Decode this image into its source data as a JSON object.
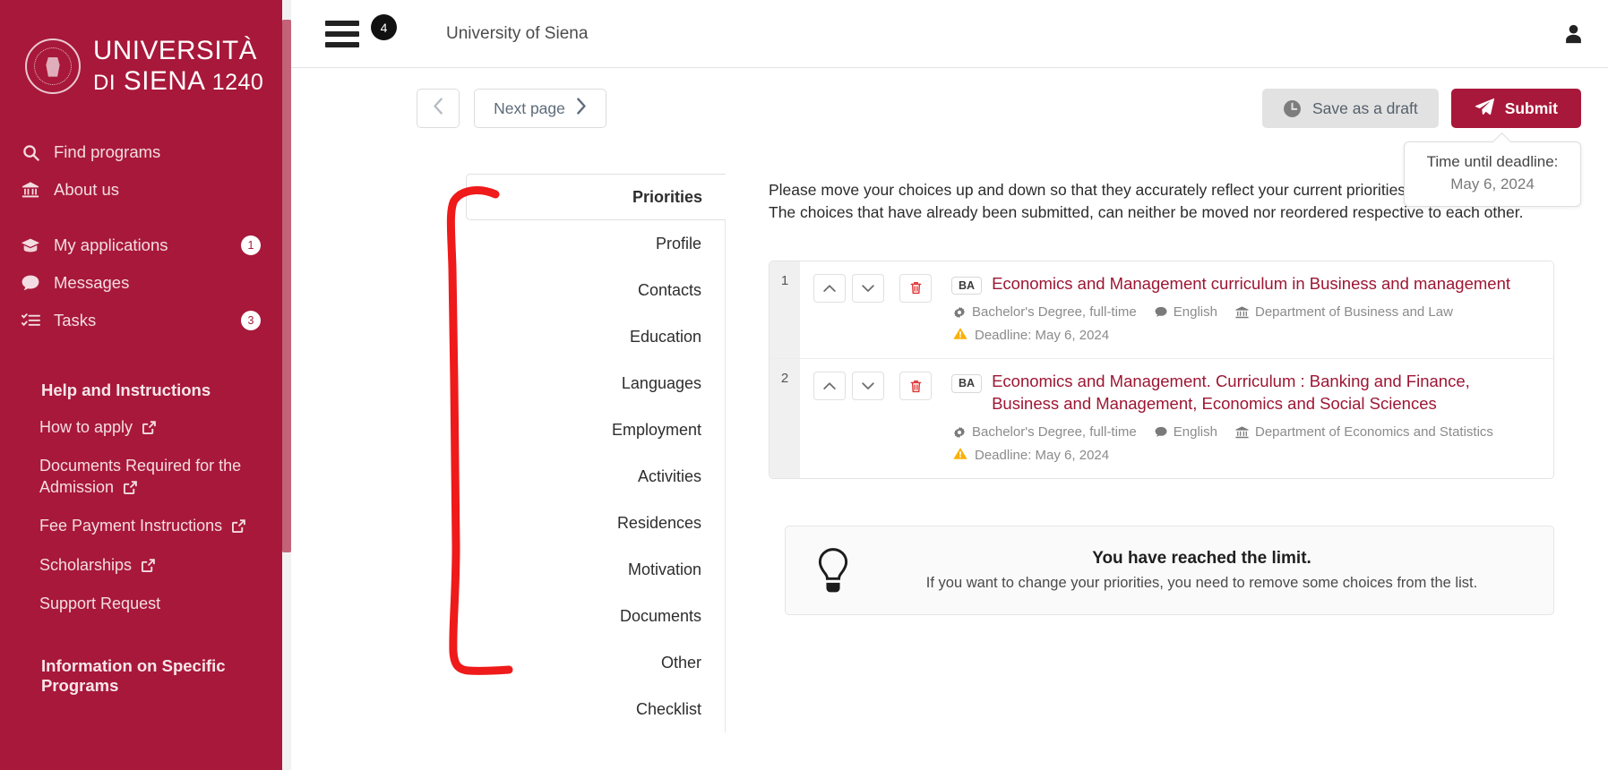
{
  "sidebar": {
    "brand": {
      "line1": "UNIVERSITÀ",
      "line2_prefix": "DI",
      "line2_main": "SIENA",
      "year": "1240",
      "crest_icon": "university-crest-icon"
    },
    "nav": [
      {
        "label": "Find programs",
        "icon": "search-icon",
        "badge": ""
      },
      {
        "label": "About us",
        "icon": "bank-icon",
        "badge": ""
      },
      {
        "label": "My applications",
        "icon": "graduation-cap-icon",
        "badge": "1"
      },
      {
        "label": "Messages",
        "icon": "chat-bubble-icon",
        "badge": ""
      },
      {
        "label": "Tasks",
        "icon": "checklist-icon",
        "badge": "3"
      }
    ],
    "help_title": "Help and Instructions",
    "help_links": [
      {
        "label": "How to apply",
        "external": true
      },
      {
        "label": "Documents Required for the Admission",
        "external": true
      },
      {
        "label": "Fee Payment Instructions",
        "external": true
      },
      {
        "label": "Scholarships",
        "external": true
      },
      {
        "label": "Support Request",
        "external": false
      }
    ],
    "section_title_2": "Information on Specific Programs",
    "accent_color": "#a8183a"
  },
  "topbar": {
    "menu_icon": "hamburger-menu-icon",
    "menu_badge": "4",
    "title": "University of Siena",
    "account_icon": "user-account-icon"
  },
  "actionbar": {
    "prev_label": "",
    "prev_icon": "chevron-left-icon",
    "next_label": "Next page",
    "next_icon": "chevron-right-icon",
    "save_draft_label": "Save as a draft",
    "save_draft_icon": "clock-icon",
    "submit_label": "Submit",
    "submit_icon": "paper-plane-icon",
    "submit_color": "#a8183a"
  },
  "tooltip": {
    "line1": "Time until deadline:",
    "line2": "May 6, 2024"
  },
  "tabs": [
    {
      "label": "Priorities",
      "active": true
    },
    {
      "label": "Profile",
      "active": false
    },
    {
      "label": "Contacts",
      "active": false
    },
    {
      "label": "Education",
      "active": false
    },
    {
      "label": "Languages",
      "active": false
    },
    {
      "label": "Employment",
      "active": false
    },
    {
      "label": "Activities",
      "active": false
    },
    {
      "label": "Residences",
      "active": false
    },
    {
      "label": "Motivation",
      "active": false
    },
    {
      "label": "Documents",
      "active": false
    },
    {
      "label": "Other",
      "active": false
    },
    {
      "label": "Checklist",
      "active": false
    }
  ],
  "intro": {
    "line1": "Please move your choices up and down so that they accurately reflect your current priorities.",
    "line2": "The choices that have already been submitted, can neither be moved nor reordered respective to each other."
  },
  "choices": [
    {
      "order": "1",
      "up_icon": "chevron-up-icon",
      "down_icon": "chevron-down-icon",
      "delete_icon": "trash-icon",
      "level_badge": "BA",
      "title": "Economics and Management curriculum in Business and management",
      "degree": "Bachelor's Degree, full-time",
      "language": "English",
      "department": "Department of Business and Law",
      "deadline": "Deadline: May 6, 2024"
    },
    {
      "order": "2",
      "up_icon": "chevron-up-icon",
      "down_icon": "chevron-down-icon",
      "delete_icon": "trash-icon",
      "level_badge": "BA",
      "title": "Economics and Management. Curriculum : Banking and Finance, Business and Management, Economics and Social Sciences",
      "degree": "Bachelor's Degree, full-time",
      "language": "English",
      "department": "Department of Economics and Statistics",
      "deadline": "Deadline: May 6, 2024"
    }
  ],
  "limit_notice": {
    "icon": "lightbulb-icon",
    "title": "You have reached the limit.",
    "subtitle": "If you want to change your priorities, you need to remove some choices from the list."
  },
  "annotation": {
    "type": "hand-drawn-bracket",
    "color": "#ef1a1a"
  }
}
